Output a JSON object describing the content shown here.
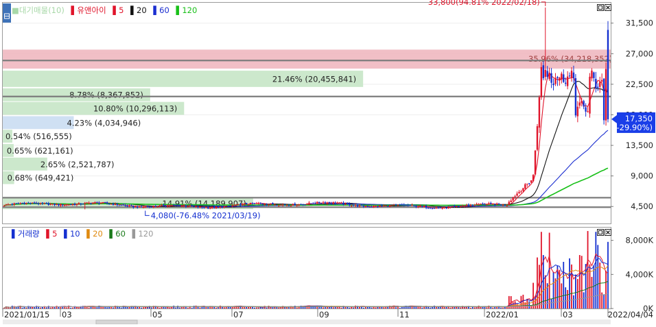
{
  "colors": {
    "up": "#e0142a",
    "down": "#1530d0",
    "ma5": "#e0142a",
    "ma20": "#111111",
    "ma60": "#1c2fd0",
    "ma120": "#18c018",
    "price_box": "#1a3ee8",
    "profile": "#cce8cc",
    "profile_sel": "#cfe0f3",
    "resist_band": "#f0b8c0",
    "vol_ma5": "#e0142a",
    "vol_ma10": "#1530d0",
    "vol_ma20": "#e08a10",
    "vol_ma60": "#1a7a1a",
    "vol_ma120": "#999999"
  },
  "icons": {
    "corner": "settings-square-icon",
    "maximize": "maximize-icon",
    "close": "close-icon"
  },
  "legend_price": [
    {
      "label": "대기매물(10)",
      "color": "#a8d8a8"
    },
    {
      "label": "유앤아이",
      "color": "#e0142a"
    },
    {
      "label": "5",
      "color": "#e0142a"
    },
    {
      "label": "20",
      "color": "#111111"
    },
    {
      "label": "60",
      "color": "#1c2fd0"
    },
    {
      "label": "120",
      "color": "#18c018"
    }
  ],
  "legend_volume": [
    {
      "label": "거래량",
      "color": "#1530d0"
    },
    {
      "label": "5",
      "color": "#e0142a"
    },
    {
      "label": "10",
      "color": "#1530d0"
    },
    {
      "label": "20",
      "color": "#e08a10"
    },
    {
      "label": "60",
      "color": "#1a7a1a"
    },
    {
      "label": "120",
      "color": "#999999"
    }
  ],
  "chart_data": [
    {
      "type": "candlestick",
      "name": "유앤아이",
      "x_ticks": [
        "2021/01/15",
        "03",
        "05",
        "07",
        "09",
        "11",
        "2022/01",
        "03",
        "2022/04/04"
      ],
      "y_ticks": [
        "4,500",
        "9,000",
        "13,500",
        "18,000",
        "22,500",
        "27,000",
        "31,500"
      ],
      "ylim": [
        2000,
        34500
      ],
      "current_price": "17,350",
      "current_change": "(-29.90%)",
      "high_annotation": "33,800(94.81% 2022/02/18)",
      "low_annotation": "4,080(-76.48% 2021/03/19)",
      "horizontal_lines": [
        26000,
        20700,
        5800,
        4400
      ],
      "volume_profile": [
        {
          "label": "35.96% (34,218,352)",
          "price_low": 24800,
          "price_high": 27600
        },
        {
          "label": "21.46% (20,455,841)",
          "price_low": 22000,
          "price_high": 24500
        },
        {
          "label": "8.78% (8,367,852)",
          "price_low": 19900,
          "price_high": 21900
        },
        {
          "label": "10.80% (10,296,113)",
          "price_low": 17900,
          "price_high": 19900
        },
        {
          "label": "4.23% (4,034,946)",
          "price_low": 15800,
          "price_high": 17800
        },
        {
          "label": "0.54% (516,555)",
          "price_low": 13800,
          "price_high": 15800
        },
        {
          "label": "0.65% (621,161)",
          "price_low": 11700,
          "price_high": 13700
        },
        {
          "label": "2.65% (2,521,787)",
          "price_low": 9700,
          "price_high": 11700
        },
        {
          "label": "0.68% (649,421)",
          "price_low": 7700,
          "price_high": 9700
        },
        {
          "label": "14.91% (14,189,907)",
          "price_low": 4000,
          "price_high": 5900
        }
      ],
      "ma_periods": [
        5,
        20,
        60,
        120
      ]
    },
    {
      "type": "bar",
      "name": "거래량",
      "y_ticks": [
        "0K",
        "4,000K",
        "8,000K"
      ],
      "ylim": [
        0,
        9500
      ],
      "unit": "K",
      "ma_periods": [
        5,
        10,
        20,
        60,
        120
      ]
    }
  ]
}
